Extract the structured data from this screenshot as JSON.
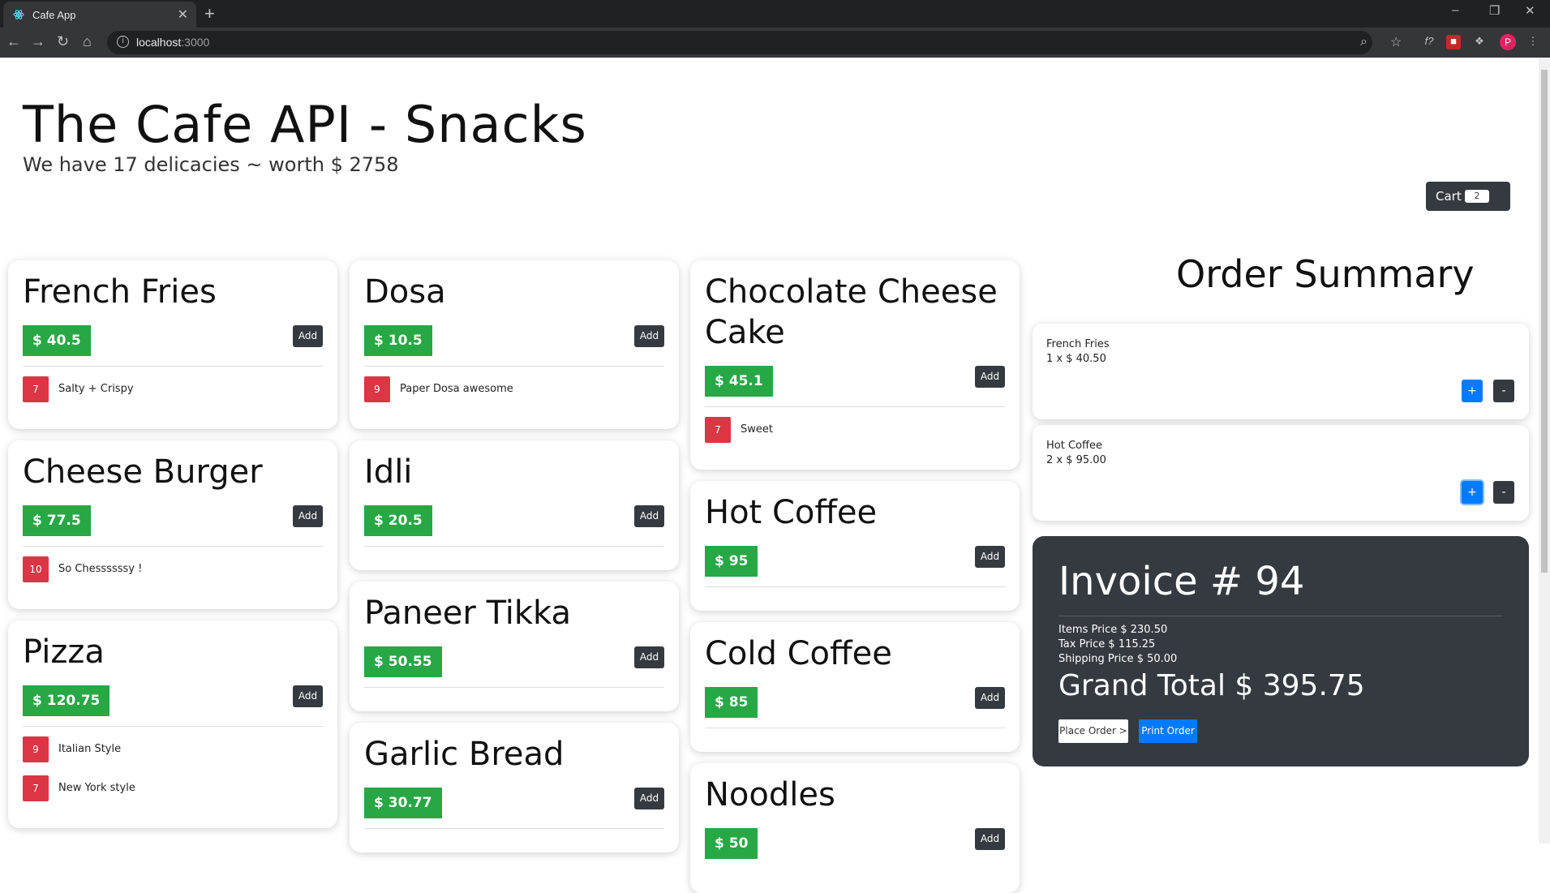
{
  "browser": {
    "tab_title": "Cafe App",
    "tab_close": "✕",
    "new_tab": "+",
    "url_host": "localhost",
    "url_port": ":3000",
    "profile_initial": "P"
  },
  "header": {
    "title": "The Cafe API - Snacks",
    "subtitle": "We have 17 delicacies ~ worth $ 2758"
  },
  "cart": {
    "label": "Cart",
    "count": "2"
  },
  "menu": {
    "add_label": "Add",
    "items": [
      {
        "name": "French Fries",
        "price": "$ 40.5",
        "tags": [
          {
            "count": "7",
            "text": "Salty + Crispy"
          }
        ]
      },
      {
        "name": "Cheese Burger",
        "price": "$ 77.5",
        "tags": [
          {
            "count": "10",
            "text": "So Chessssssy !"
          }
        ]
      },
      {
        "name": "Pizza",
        "price": "$ 120.75",
        "tags": [
          {
            "count": "9",
            "text": "Italian Style"
          },
          {
            "count": "7",
            "text": "New York style"
          }
        ]
      },
      {
        "name": "Dosa",
        "price": "$ 10.5",
        "tags": [
          {
            "count": "9",
            "text": "Paper Dosa awesome"
          }
        ]
      },
      {
        "name": "Idli",
        "price": "$ 20.5",
        "tags": []
      },
      {
        "name": "Paneer Tikka",
        "price": "$ 50.55",
        "tags": []
      },
      {
        "name": "Garlic Bread",
        "price": "$ 30.77",
        "tags": []
      },
      {
        "name": "Chocolate Cheese Cake",
        "price": "$ 45.1",
        "tags": [
          {
            "count": "7",
            "text": "Sweet"
          }
        ]
      },
      {
        "name": "Hot Coffee",
        "price": "$ 95",
        "tags": []
      },
      {
        "name": "Cold Coffee",
        "price": "$ 85",
        "tags": []
      },
      {
        "name": "Noodles",
        "price": "$ 50",
        "tags": []
      }
    ]
  },
  "summary": {
    "title": "Order Summary",
    "plus_label": "+",
    "minus_label": "-",
    "items": [
      {
        "name": "French Fries",
        "qty_line": "1 x $ 40.50"
      },
      {
        "name": "Hot Coffee",
        "qty_line": "2 x $ 95.00"
      }
    ]
  },
  "invoice": {
    "title": "Invoice # 94",
    "items_price": "Items Price $ 230.50",
    "tax_price": "Tax Price $ 115.25",
    "shipping_price": "Shipping Price $ 50.00",
    "grand_total": "Grand Total $ 395.75",
    "place_order": "Place Order >",
    "print_order": "Print Order"
  },
  "colors": {
    "price_badge": "#28a745",
    "tag_badge": "#dc3545",
    "dark": "#343a40",
    "primary": "#007bff"
  }
}
